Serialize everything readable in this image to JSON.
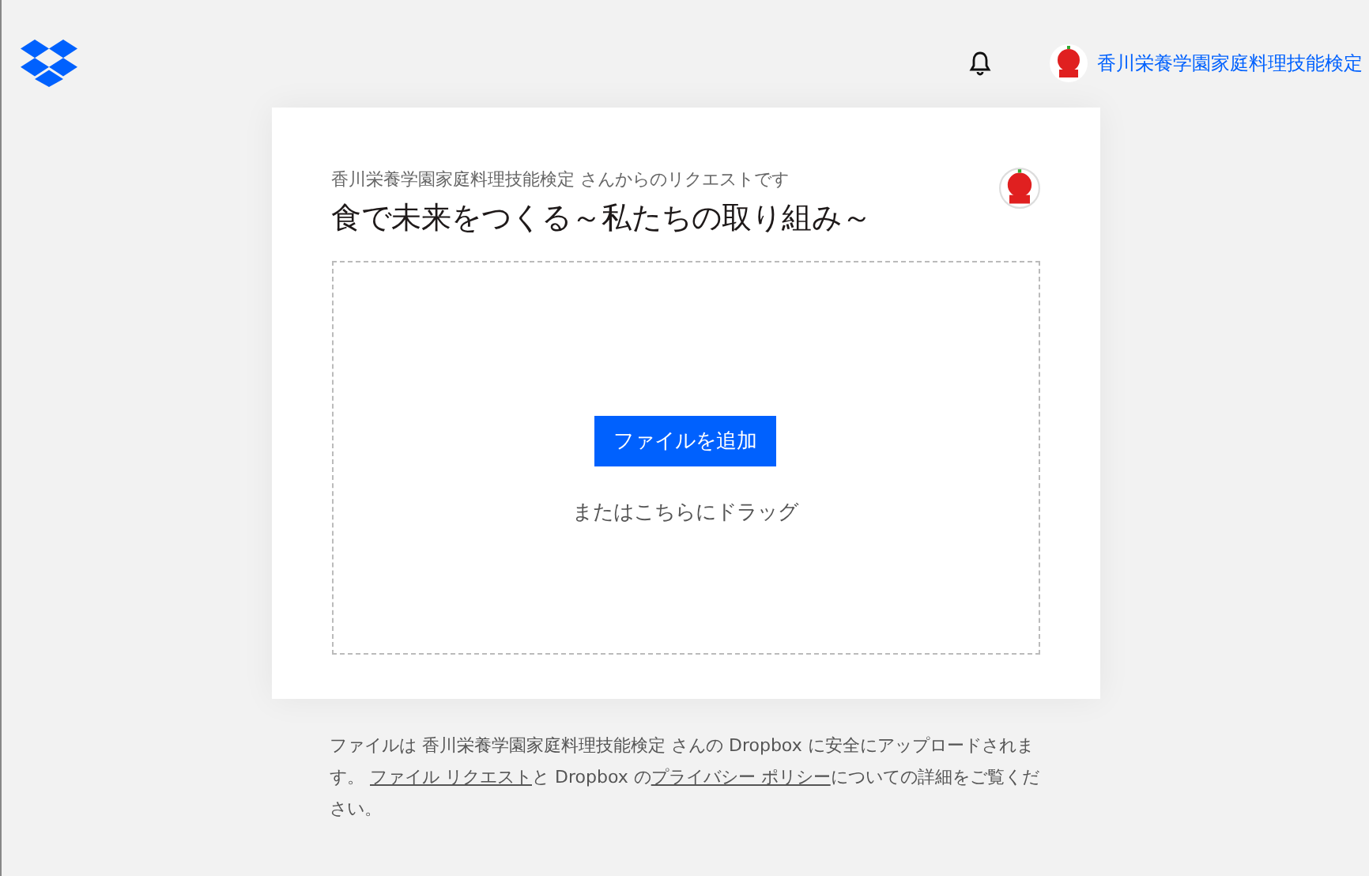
{
  "header": {
    "account_name": "香川栄養学園家庭料理技能検定"
  },
  "request": {
    "from_line": "香川栄養学園家庭料理技能検定 さんからのリクエストです",
    "title": "食で未来をつくる～私たちの取り組み～"
  },
  "dropzone": {
    "button": "ファイルを追加",
    "hint": "またはこちらにドラッグ"
  },
  "footer": [
    {
      "kind": "text",
      "text": "ファイルは 香川栄養学園家庭料理技能検定 さんの Dropbox に安全にアップロードされます。 "
    },
    {
      "kind": "link",
      "text": "ファイル リクエスト"
    },
    {
      "kind": "text",
      "text": "と Dropbox の"
    },
    {
      "kind": "link",
      "text": "プライバシー ポリシー"
    },
    {
      "kind": "text",
      "text": "についての詳細をご覧ください。"
    }
  ]
}
